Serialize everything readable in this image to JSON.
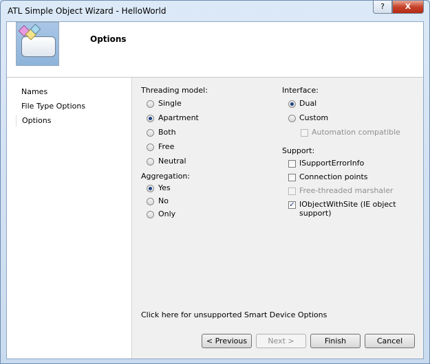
{
  "window": {
    "title": "ATL Simple Object Wizard - HelloWorld",
    "help_label": "?",
    "close_label": "X"
  },
  "header": {
    "title": "Options",
    "image_icon": "atl-object-wizard-icon"
  },
  "nav": {
    "items": [
      {
        "label": "Names"
      },
      {
        "label": "File Type Options"
      },
      {
        "label": "Options",
        "selected": true
      }
    ]
  },
  "threading": {
    "label": "Threading model:",
    "options": [
      {
        "label": "Single",
        "selected": false
      },
      {
        "label": "Apartment",
        "selected": true
      },
      {
        "label": "Both",
        "selected": false
      },
      {
        "label": "Free",
        "selected": false
      },
      {
        "label": "Neutral",
        "selected": false
      }
    ]
  },
  "aggregation": {
    "label": "Aggregation:",
    "options": [
      {
        "label": "Yes",
        "selected": true
      },
      {
        "label": "No",
        "selected": false
      },
      {
        "label": "Only",
        "selected": false
      }
    ]
  },
  "interface": {
    "label": "Interface:",
    "options": [
      {
        "label": "Dual",
        "selected": true
      },
      {
        "label": "Custom",
        "selected": false
      }
    ],
    "automation_label": "Automation compatible"
  },
  "support": {
    "label": "Support:",
    "items": [
      {
        "label": "ISupportErrorInfo",
        "checked": false,
        "enabled": true
      },
      {
        "label": "Connection points",
        "checked": false,
        "enabled": true
      },
      {
        "label": "Free-threaded marshaler",
        "checked": false,
        "enabled": false
      },
      {
        "label": "IObjectWithSite (IE object",
        "label2": "support)",
        "checked": true,
        "enabled": true
      }
    ]
  },
  "smart_device_link": "Click here for unsupported Smart Device Options",
  "buttons": {
    "previous": "< Previous",
    "next": "Next >",
    "finish": "Finish",
    "cancel": "Cancel"
  }
}
